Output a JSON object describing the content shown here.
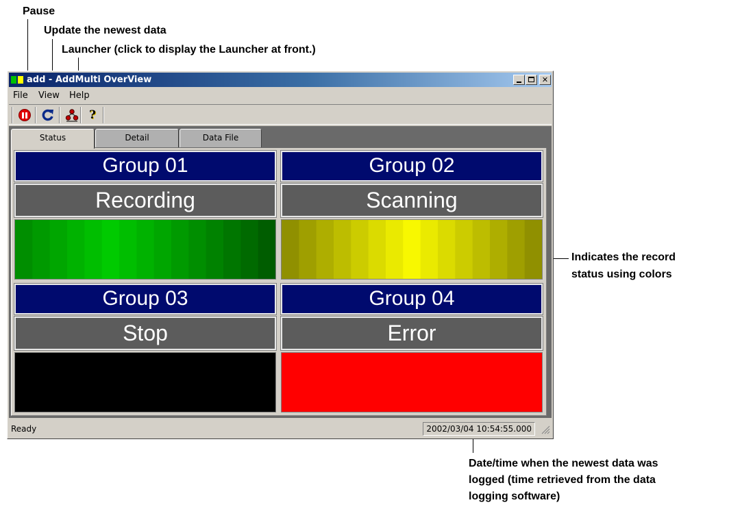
{
  "callouts": {
    "pause": "Pause",
    "update": "Update the newest data",
    "launcher": "Launcher (click to display the Launcher at front.)",
    "record_status": [
      "Indicates the record",
      "status using colors"
    ],
    "datetime": [
      "Date/time when the newest data was",
      "logged (time retrieved from the data",
      "logging software)"
    ]
  },
  "window": {
    "title": "add - AddMulti OverView",
    "controls": {
      "minimize": "_",
      "maximize": "□",
      "close": "✕"
    }
  },
  "menu": [
    "File",
    "View",
    "Help"
  ],
  "toolbar": {
    "buttons": [
      {
        "name": "pause",
        "icon": "pause-icon"
      },
      {
        "name": "update",
        "icon": "refresh-icon"
      },
      {
        "name": "launcher",
        "icon": "launcher-icon"
      },
      {
        "name": "help",
        "icon": "help-icon",
        "glyph": "?"
      }
    ]
  },
  "tabs": [
    "Status",
    "Detail",
    "Data File"
  ],
  "active_tab": "Status",
  "groups": [
    {
      "name": "Group 01",
      "status": "Recording",
      "color_scheme": "green",
      "base": "#00b000"
    },
    {
      "name": "Group 02",
      "status": "Scanning",
      "color_scheme": "yellow",
      "base": "#d8d800"
    },
    {
      "name": "Group 03",
      "status": "Stop",
      "color_scheme": "black",
      "base": "#000000"
    },
    {
      "name": "Group 04",
      "status": "Error",
      "color_scheme": "red",
      "base": "#ff0000"
    }
  ],
  "statusbar": {
    "status": "Ready",
    "datetime": "2002/03/04 10:54:55.000"
  }
}
